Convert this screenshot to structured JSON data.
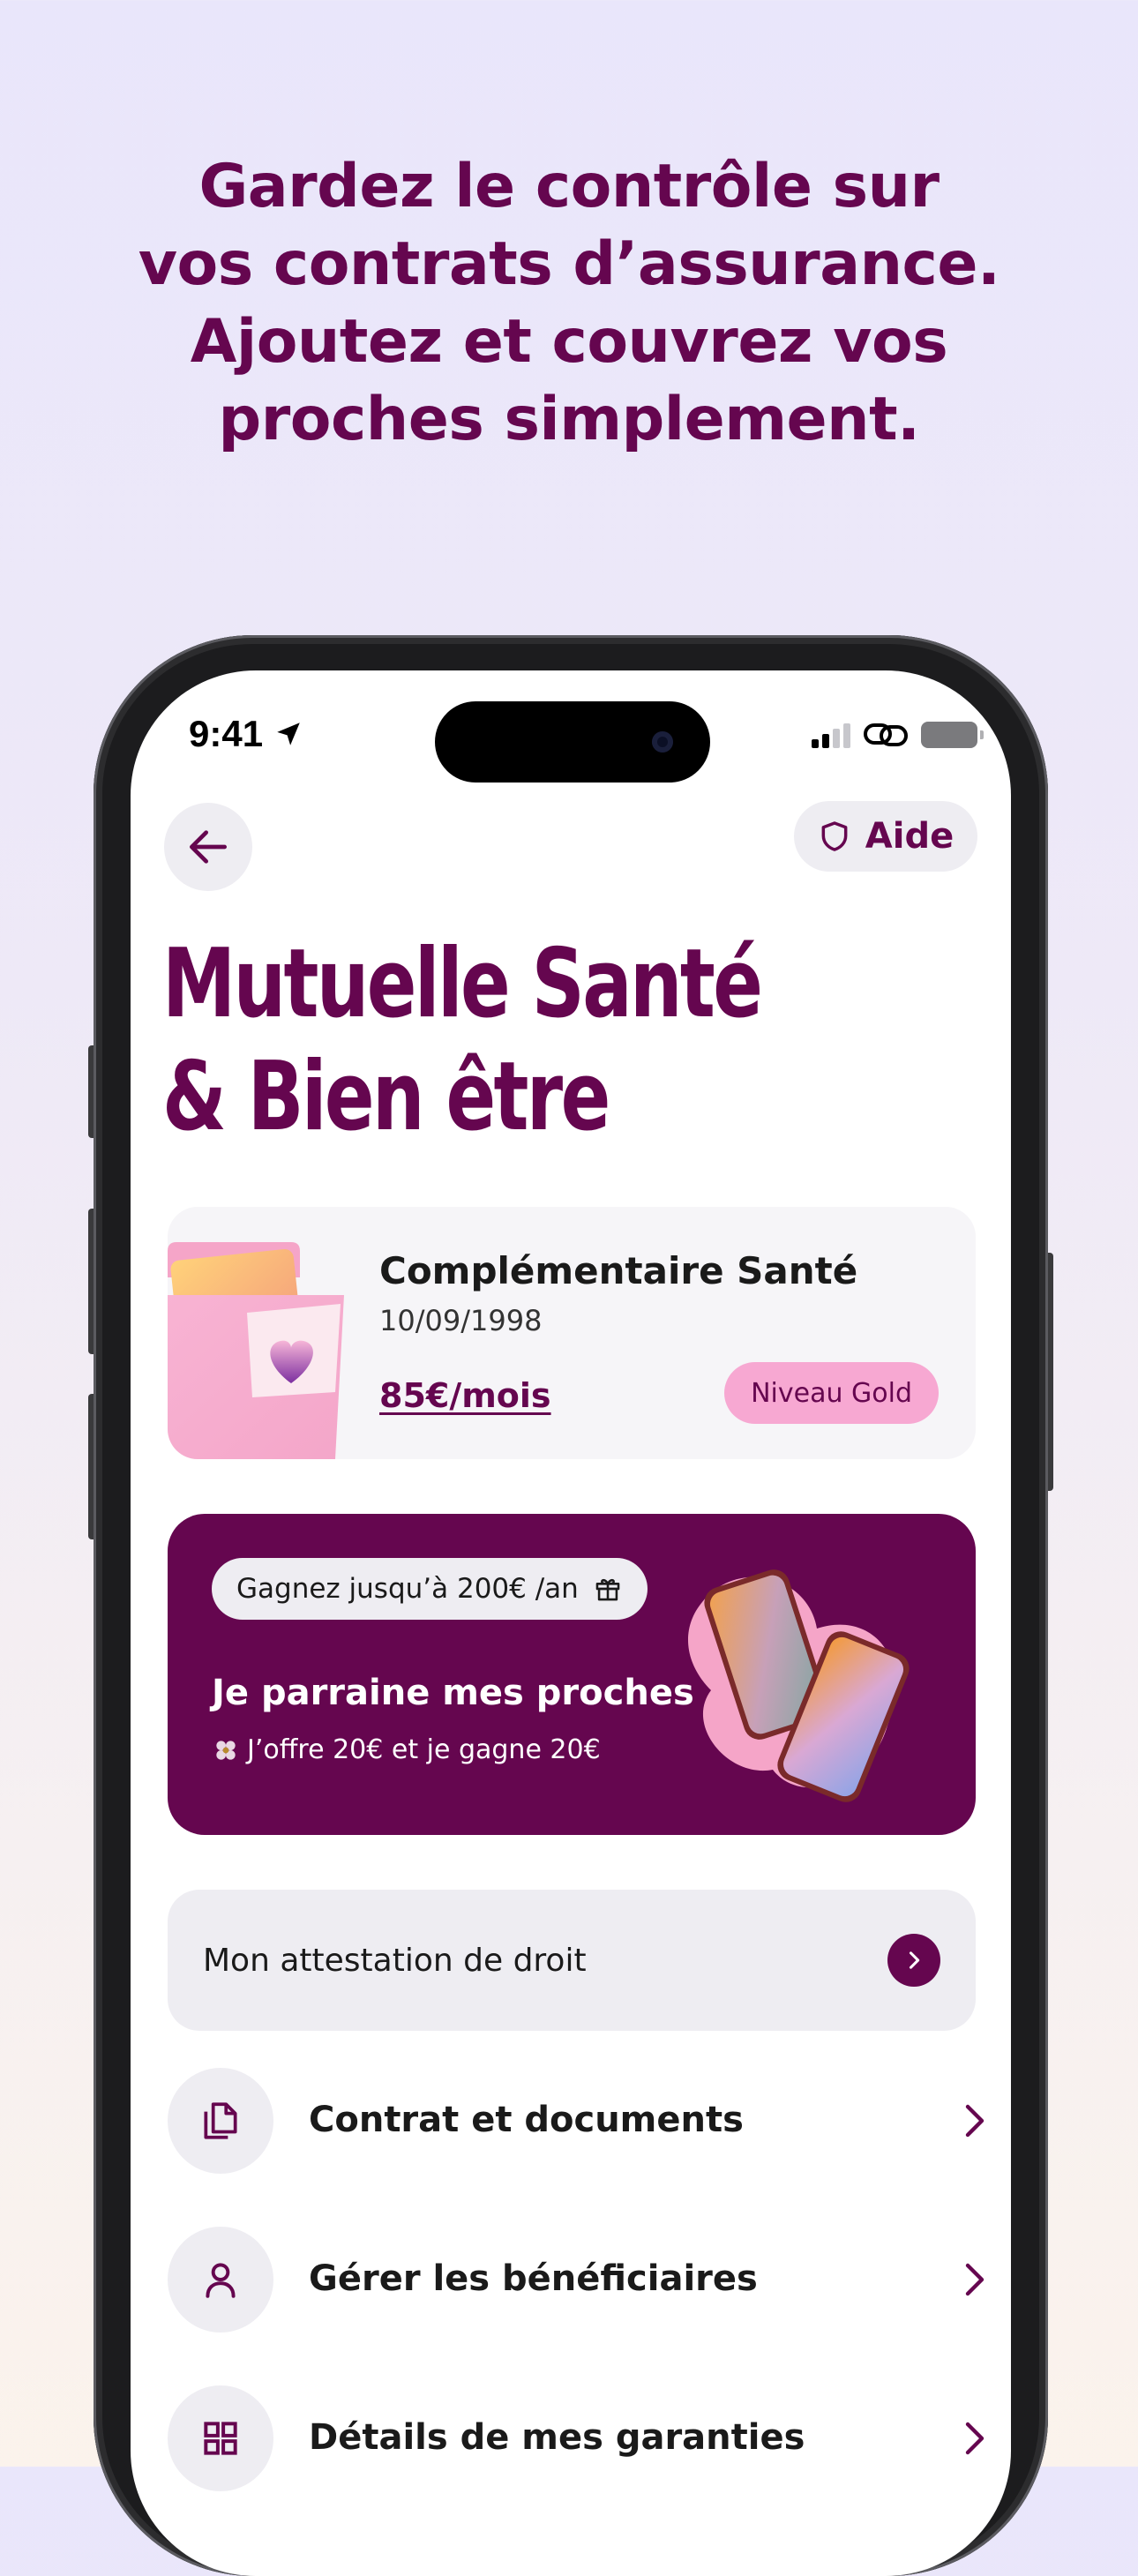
{
  "headline": {
    "lines": [
      "Gardez le contrôle sur",
      "vos contrats d’assurance.",
      "Ajoutez et couvrez vos",
      "proches simplement."
    ]
  },
  "status_bar": {
    "time": "9:41"
  },
  "header": {
    "back_icon": "arrow-left-icon",
    "help_label": "Aide",
    "help_icon": "shield-icon"
  },
  "page_title": {
    "line1": "Mutuelle Santé",
    "line2": "& Bien être"
  },
  "contract": {
    "name": "Complémentaire Santé",
    "date": "10/09/1998",
    "price": "85€/mois",
    "level": "Niveau Gold"
  },
  "promo": {
    "pill": "Gagnez jusqu’à 200€ /an",
    "title": "Je parraine mes proches",
    "subtitle": "J’offre 20€ et je gagne 20€"
  },
  "attestation": {
    "label": "Mon attestation de droit"
  },
  "menu": [
    {
      "label": "Contrat et documents",
      "icon": "documents-icon"
    },
    {
      "label": "Gérer les bénéficiaires",
      "icon": "user-icon"
    },
    {
      "label": "Détails de mes garanties",
      "icon": "grid-icon"
    }
  ],
  "colors": {
    "brand": "#65064F",
    "badge": "#F7A8D2",
    "surface": "#EEEDF2"
  }
}
